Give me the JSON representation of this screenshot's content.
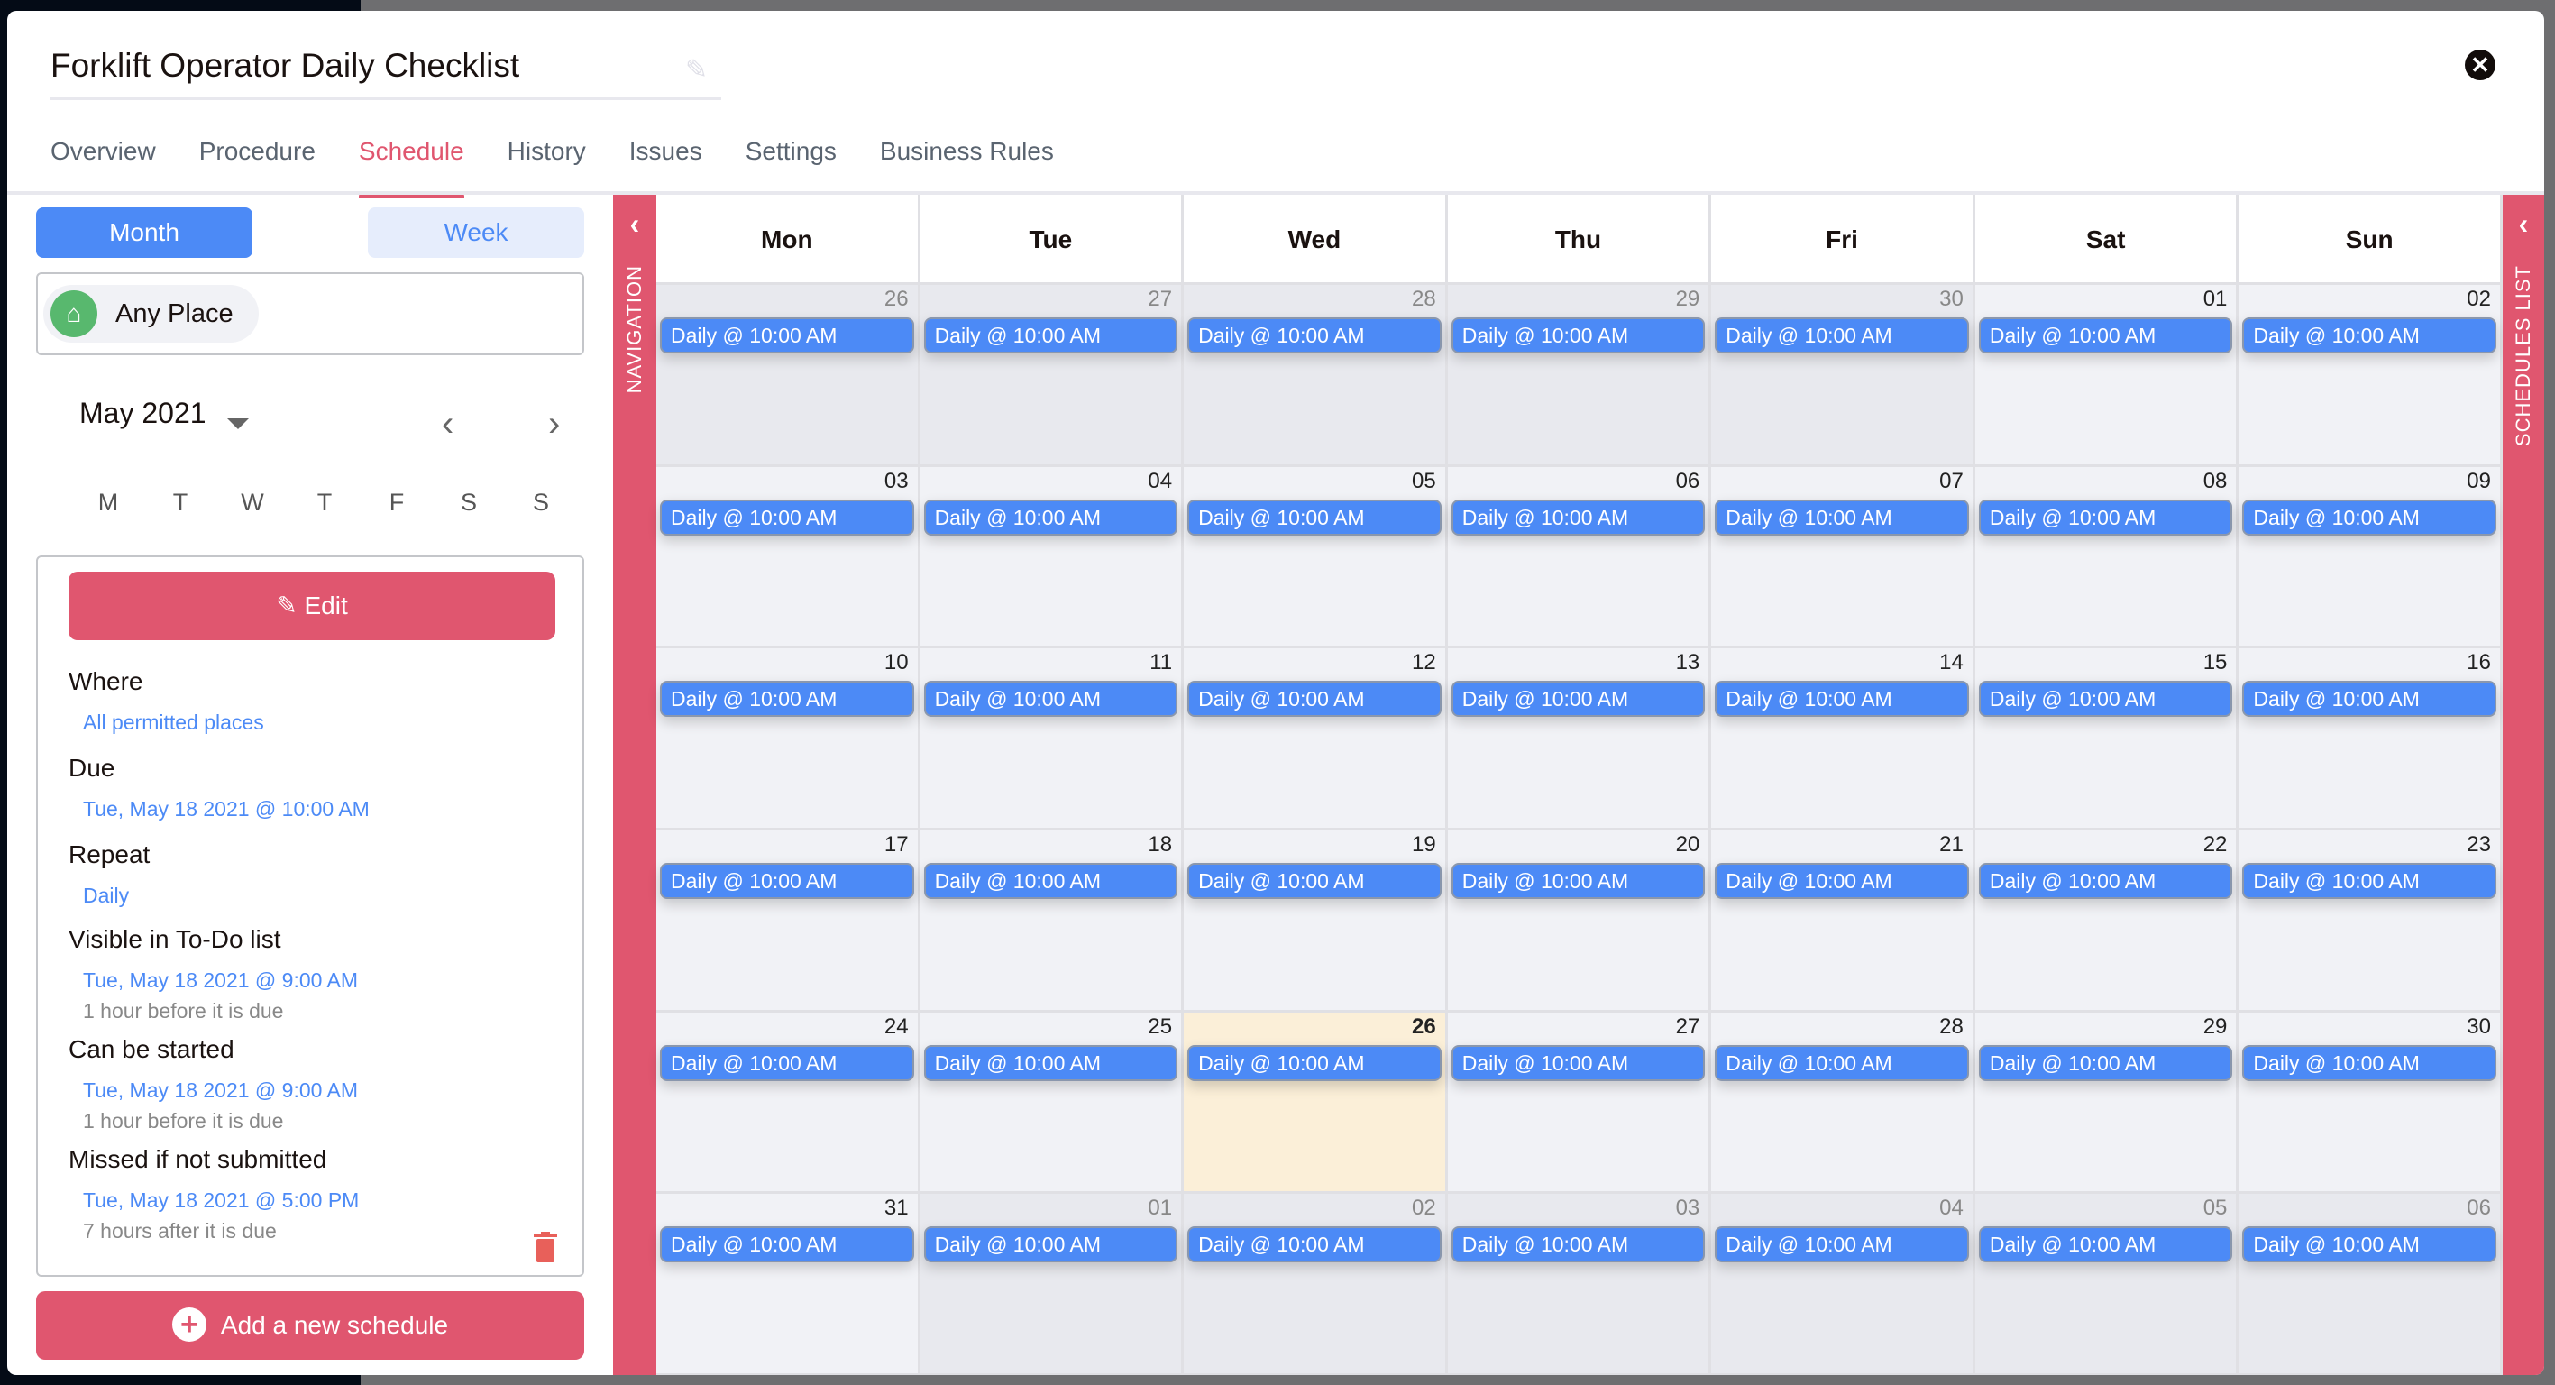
{
  "title": "Forklift Operator Daily Checklist",
  "tabs": [
    {
      "label": "Overview"
    },
    {
      "label": "Procedure"
    },
    {
      "label": "Schedule",
      "active": true
    },
    {
      "label": "History"
    },
    {
      "label": "Issues"
    },
    {
      "label": "Settings"
    },
    {
      "label": "Business Rules"
    }
  ],
  "view_toggle": {
    "month": "Month",
    "week": "Week",
    "selected": "Month"
  },
  "place_chip": "Any Place",
  "mini_calendar": {
    "month_label": "May 2021",
    "weekdays": [
      "M",
      "T",
      "W",
      "T",
      "F",
      "S",
      "S"
    ]
  },
  "details": {
    "edit_label": "Edit",
    "where": {
      "label": "Where",
      "value": "All permitted places"
    },
    "due": {
      "label": "Due",
      "value": "Tue, May 18 2021 @ 10:00 AM"
    },
    "repeat": {
      "label": "Repeat",
      "value": "Daily"
    },
    "visible": {
      "label": "Visible in To-Do list",
      "value": "Tue, May 18 2021 @ 9:00 AM",
      "note": "1 hour before it is due"
    },
    "started": {
      "label": "Can be started",
      "value": "Tue, May 18 2021 @ 9:00 AM",
      "note": "1 hour before it is due"
    },
    "missed": {
      "label": "Missed if not submitted",
      "value": "Tue, May 18 2021 @ 5:00 PM",
      "note": "7 hours after it is due"
    }
  },
  "add_schedule_label": "Add a new schedule",
  "navigation_label": "NAVIGATION",
  "schedules_list_label": "SCHEDULES LIST",
  "calendar": {
    "day_headers": [
      "Mon",
      "Tue",
      "Wed",
      "Thu",
      "Fri",
      "Sat",
      "Sun"
    ],
    "event_label": "Daily @ 10:00 AM",
    "today": "26",
    "weeks": [
      [
        {
          "d": "26",
          "out": true
        },
        {
          "d": "27",
          "out": true
        },
        {
          "d": "28",
          "out": true
        },
        {
          "d": "29",
          "out": true
        },
        {
          "d": "30",
          "out": true
        },
        {
          "d": "01"
        },
        {
          "d": "02"
        }
      ],
      [
        {
          "d": "03"
        },
        {
          "d": "04"
        },
        {
          "d": "05"
        },
        {
          "d": "06"
        },
        {
          "d": "07"
        },
        {
          "d": "08"
        },
        {
          "d": "09"
        }
      ],
      [
        {
          "d": "10"
        },
        {
          "d": "11"
        },
        {
          "d": "12"
        },
        {
          "d": "13"
        },
        {
          "d": "14"
        },
        {
          "d": "15"
        },
        {
          "d": "16"
        }
      ],
      [
        {
          "d": "17"
        },
        {
          "d": "18"
        },
        {
          "d": "19"
        },
        {
          "d": "20"
        },
        {
          "d": "21"
        },
        {
          "d": "22"
        },
        {
          "d": "23"
        }
      ],
      [
        {
          "d": "24"
        },
        {
          "d": "25"
        },
        {
          "d": "26",
          "today": true
        },
        {
          "d": "27"
        },
        {
          "d": "28"
        },
        {
          "d": "29"
        },
        {
          "d": "30"
        }
      ],
      [
        {
          "d": "31"
        },
        {
          "d": "01",
          "out": true
        },
        {
          "d": "02",
          "out": true
        },
        {
          "d": "03",
          "out": true
        },
        {
          "d": "04",
          "out": true
        },
        {
          "d": "05",
          "out": true
        },
        {
          "d": "06",
          "out": true
        }
      ]
    ]
  },
  "colors": {
    "accent": "#e0566f",
    "event": "#4c8af6",
    "today": "#fbefd8"
  }
}
